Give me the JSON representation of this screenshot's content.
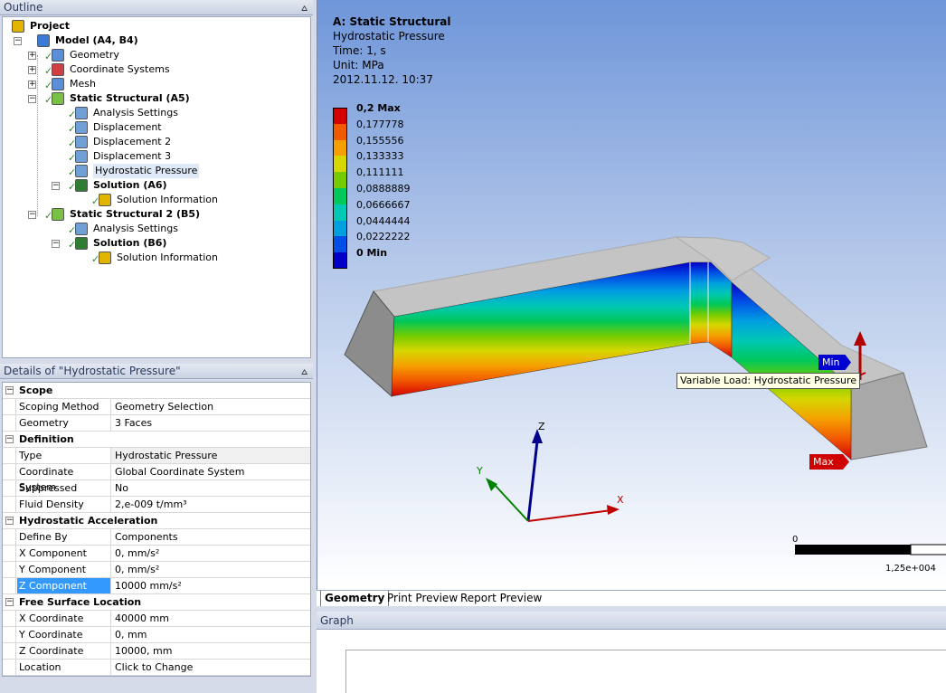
{
  "outline": {
    "title": "Outline",
    "pin": "⩟",
    "tree": [
      {
        "label": "Project",
        "bold": true
      },
      {
        "label": "Model (A4, B4)",
        "bold": true
      },
      {
        "label": "Geometry",
        "bold": false
      },
      {
        "label": "Coordinate Systems",
        "bold": false
      },
      {
        "label": "Mesh",
        "bold": false
      },
      {
        "label": "Static Structural (A5)",
        "bold": true
      },
      {
        "label": "Analysis Settings",
        "bold": false
      },
      {
        "label": "Displacement",
        "bold": false
      },
      {
        "label": "Displacement 2",
        "bold": false
      },
      {
        "label": "Displacement 3",
        "bold": false
      },
      {
        "label": "Hydrostatic Pressure",
        "bold": false
      },
      {
        "label": "Solution (A6)",
        "bold": true
      },
      {
        "label": "Solution Information",
        "bold": false
      },
      {
        "label": "Static Structural 2 (B5)",
        "bold": true
      },
      {
        "label": "Analysis Settings",
        "bold": false
      },
      {
        "label": "Solution (B6)",
        "bold": true
      },
      {
        "label": "Solution Information",
        "bold": false
      }
    ]
  },
  "details": {
    "title": "Details of \"Hydrostatic Pressure\"",
    "rows": [
      {
        "kind": "cat",
        "label": "Scope"
      },
      {
        "kind": "prop",
        "label": "Scoping Method",
        "value": "Geometry Selection"
      },
      {
        "kind": "prop",
        "label": "Geometry",
        "value": "3 Faces"
      },
      {
        "kind": "cat",
        "label": "Definition"
      },
      {
        "kind": "prop",
        "label": "Type",
        "value": "Hydrostatic Pressure",
        "readonly": true
      },
      {
        "kind": "prop",
        "label": "Coordinate System",
        "value": "Global Coordinate System"
      },
      {
        "kind": "prop",
        "label": "Suppressed",
        "value": "No"
      },
      {
        "kind": "prop",
        "label": "Fluid Density",
        "value": "2,e-009 t/mm³"
      },
      {
        "kind": "cat",
        "label": "Hydrostatic Acceleration"
      },
      {
        "kind": "prop",
        "label": "Define By",
        "value": "Components"
      },
      {
        "kind": "prop",
        "label": "X Component",
        "value": "0, mm/s²"
      },
      {
        "kind": "prop",
        "label": "Y Component",
        "value": "0, mm/s²"
      },
      {
        "kind": "prop",
        "label": "Z Component",
        "value": "10000 mm/s²",
        "selected": true
      },
      {
        "kind": "cat",
        "label": "Free Surface Location"
      },
      {
        "kind": "prop",
        "label": "X Coordinate",
        "value": "40000 mm"
      },
      {
        "kind": "prop",
        "label": "Y Coordinate",
        "value": "0, mm"
      },
      {
        "kind": "prop",
        "label": "Z Coordinate",
        "value": "10000, mm"
      },
      {
        "kind": "prop",
        "label": "Location",
        "value": "Click to Change"
      }
    ]
  },
  "viewport": {
    "info": {
      "title": "A: Static Structural",
      "result": "Hydrostatic Pressure",
      "time": "Time: 1, s",
      "unit": "Unit: MPa",
      "date": "2012.11.12. 10:37"
    },
    "legend": [
      {
        "label": "0,2 Max",
        "color": "#d40000",
        "bold": true
      },
      {
        "label": "0,177778",
        "color": "#f25a00"
      },
      {
        "label": "0,155556",
        "color": "#f5a000"
      },
      {
        "label": "0,133333",
        "color": "#d6d600"
      },
      {
        "label": "0,111111",
        "color": "#74cc00"
      },
      {
        "label": "0,0888889",
        "color": "#00c85a"
      },
      {
        "label": "0,0666667",
        "color": "#00c8b4"
      },
      {
        "label": "0,0444444",
        "color": "#00a0e0"
      },
      {
        "label": "0,0222222",
        "color": "#0050e6"
      },
      {
        "label": "0 Min",
        "color": "#0000c8",
        "bold": true
      }
    ],
    "min_tag": "Min",
    "max_tag": "Max",
    "tooltip": "Variable Load: Hydrostatic Pressure",
    "axes": {
      "x": "X",
      "y": "Y",
      "z": "Z"
    },
    "scale": {
      "zero": "0",
      "end": "1,25e+004"
    }
  },
  "tabs": [
    "Geometry",
    "Print Preview",
    "Report Preview"
  ],
  "graph": {
    "title": "Graph"
  }
}
